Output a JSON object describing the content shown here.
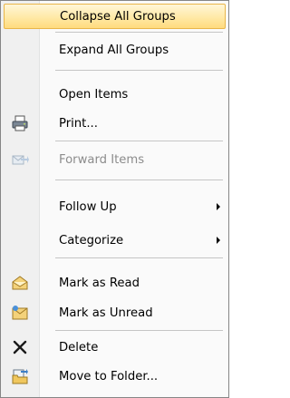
{
  "menu": {
    "items": [
      {
        "name": "collapse-all-groups",
        "label": "Collapse All Groups",
        "highlighted": true
      },
      {
        "name": "expand-all-groups",
        "label": "Expand All Groups"
      },
      {
        "name": "open-items",
        "label": "Open Items"
      },
      {
        "name": "print",
        "label": "Print...",
        "icon": "printer-icon"
      },
      {
        "name": "forward-items",
        "label": "Forward Items",
        "icon": "forward-icon",
        "disabled": true
      },
      {
        "name": "follow-up",
        "label": "Follow Up",
        "submenu": true
      },
      {
        "name": "categorize",
        "label": "Categorize",
        "submenu": true
      },
      {
        "name": "mark-as-read",
        "label": "Mark as Read",
        "icon": "envelope-open-icon"
      },
      {
        "name": "mark-as-unread",
        "label": "Mark as Unread",
        "icon": "envelope-closed-icon"
      },
      {
        "name": "delete",
        "label": "Delete",
        "icon": "delete-x-icon"
      },
      {
        "name": "move-to-folder",
        "label": "Move to Folder...",
        "icon": "move-folder-icon"
      }
    ]
  },
  "colors": {
    "highlight": "#ffe9a6",
    "highlight_border": "#e9b64a",
    "disabled_text": "#8c8c8c"
  }
}
